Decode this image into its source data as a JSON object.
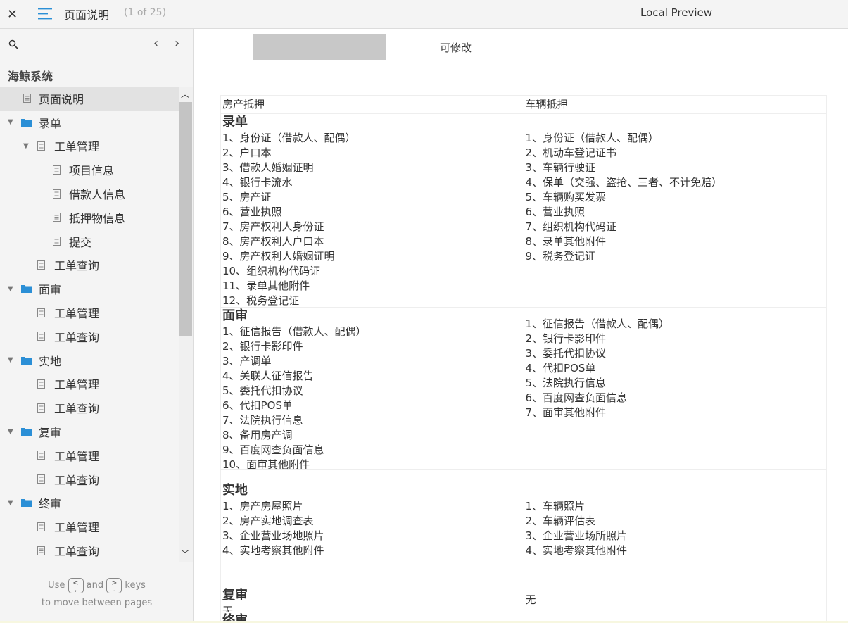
{
  "topbar": {
    "close_label": "✕",
    "title": "页面说明",
    "page_count": "(1 of 25)",
    "preview_label": "Local Preview"
  },
  "sidebar": {
    "prev_label": "‹",
    "next_label": "›",
    "system_title": "海鲸系统",
    "tree": [
      {
        "label": "页面说明",
        "type": "doc",
        "level": 0,
        "selected": true
      },
      {
        "label": "录单",
        "type": "folder",
        "level": 0
      },
      {
        "label": "工单管理",
        "type": "doc-expand",
        "level": 1
      },
      {
        "label": "项目信息",
        "type": "doc",
        "level": 2
      },
      {
        "label": "借款人信息",
        "type": "doc",
        "level": 2
      },
      {
        "label": "抵押物信息",
        "type": "doc",
        "level": 2
      },
      {
        "label": "提交",
        "type": "doc",
        "level": 2
      },
      {
        "label": "工单查询",
        "type": "doc",
        "level": 1
      },
      {
        "label": "面审",
        "type": "folder",
        "level": 0
      },
      {
        "label": "工单管理",
        "type": "doc",
        "level": 1
      },
      {
        "label": "工单查询",
        "type": "doc",
        "level": 1
      },
      {
        "label": "实地",
        "type": "folder",
        "level": 0
      },
      {
        "label": "工单管理",
        "type": "doc",
        "level": 1
      },
      {
        "label": "工单查询",
        "type": "doc",
        "level": 1
      },
      {
        "label": "复审",
        "type": "folder",
        "level": 0
      },
      {
        "label": "工单管理",
        "type": "doc",
        "level": 1
      },
      {
        "label": "工单查询",
        "type": "doc",
        "level": 1
      },
      {
        "label": "终审",
        "type": "folder",
        "level": 0
      },
      {
        "label": "工单管理",
        "type": "doc",
        "level": 1
      },
      {
        "label": "工单查询",
        "type": "doc",
        "level": 1
      }
    ],
    "hint_use": "Use",
    "hint_and": "and",
    "hint_keys": "keys",
    "hint_line2": "to move between pages",
    "key_prev": "<\n,",
    "key_next": ">\n."
  },
  "content": {
    "editable_label": "可修改",
    "headers": [
      "房产抵押",
      "车辆抵押"
    ],
    "sections": [
      {
        "title": "录单",
        "left": [
          "1、身份证（借款人、配偶）",
          "2、户口本",
          "3、借款人婚姻证明",
          "4、银行卡流水",
          "5、房产证",
          "6、营业执照",
          "7、房产权利人身份证",
          "8、房产权利人户口本",
          "9、房产权利人婚姻证明",
          "10、组织机构代码证",
          "11、录单其他附件",
          "12、税务登记证"
        ],
        "right": [
          "1、身份证（借款人、配偶）",
          "2、机动车登记证书",
          "3、车辆行驶证",
          "4、保单（交强、盗抢、三者、不计免赔）",
          "5、车辆购买发票",
          "6、营业执照",
          "7、组织机构代码证",
          "8、录单其他附件",
          "9、税务登记证"
        ]
      },
      {
        "title": "面审",
        "left": [
          "1、征信报告（借款人、配偶）",
          "2、银行卡影印件",
          "3、产调单",
          "4、关联人征信报告",
          "5、委托代扣协议",
          "6、代扣POS单",
          "7、法院执行信息",
          "8、备用房产调",
          "9、百度网查负面信息",
          "10、面审其他附件"
        ],
        "right": [
          "1、征信报告（借款人、配偶）",
          "2、银行卡影印件",
          "3、委托代扣协议",
          "4、代扣POS单",
          "5、法院执行信息",
          "6、百度网查负面信息",
          "7、面审其他附件"
        ]
      },
      {
        "title": "实地",
        "left": [
          "1、房产房屋照片",
          "2、房产实地调查表",
          "3、企业营业场地照片",
          "4、实地考察其他附件"
        ],
        "right": [
          "1、车辆照片",
          "2、车辆评估表",
          "3、企业营业场所照片",
          "4、实地考察其他附件"
        ]
      },
      {
        "title": "复审",
        "left": [
          "无"
        ],
        "right": [
          "无"
        ]
      },
      {
        "title": "终审",
        "left": [],
        "right": []
      }
    ]
  }
}
